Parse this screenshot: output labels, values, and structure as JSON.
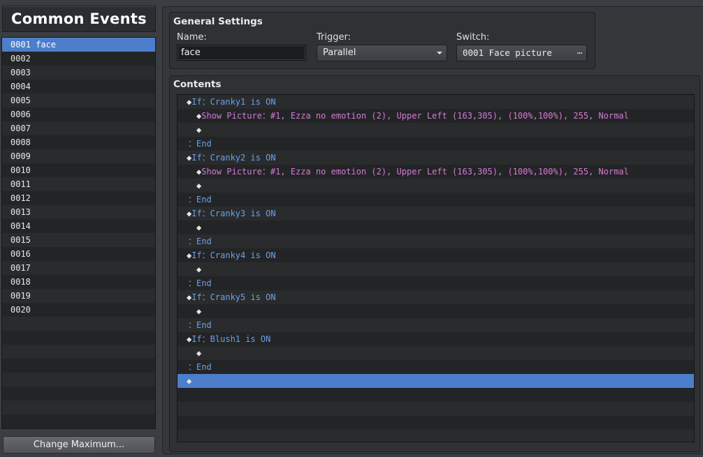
{
  "panel": {
    "title": "Common Events"
  },
  "events": [
    {
      "id": "0001",
      "name": "face",
      "selected": true
    },
    {
      "id": "0002",
      "name": ""
    },
    {
      "id": "0003",
      "name": ""
    },
    {
      "id": "0004",
      "name": ""
    },
    {
      "id": "0005",
      "name": ""
    },
    {
      "id": "0006",
      "name": ""
    },
    {
      "id": "0007",
      "name": ""
    },
    {
      "id": "0008",
      "name": ""
    },
    {
      "id": "0009",
      "name": ""
    },
    {
      "id": "0010",
      "name": ""
    },
    {
      "id": "0011",
      "name": ""
    },
    {
      "id": "0012",
      "name": ""
    },
    {
      "id": "0013",
      "name": ""
    },
    {
      "id": "0014",
      "name": ""
    },
    {
      "id": "0015",
      "name": ""
    },
    {
      "id": "0016",
      "name": ""
    },
    {
      "id": "0017",
      "name": ""
    },
    {
      "id": "0018",
      "name": ""
    },
    {
      "id": "0019",
      "name": ""
    },
    {
      "id": "0020",
      "name": ""
    }
  ],
  "change_max_label": "Change Maximum...",
  "general": {
    "title": "General Settings",
    "name_label": "Name:",
    "name_value": "face",
    "trigger_label": "Trigger:",
    "trigger_value": "Parallel",
    "switch_label": "Switch:",
    "switch_value": "0001 Face picture",
    "switch_button": "⋯"
  },
  "contents": {
    "title": "Contents",
    "commands": [
      {
        "indent": 1,
        "diamond": true,
        "text": "If：Cranky1 is ON",
        "color": "blue"
      },
      {
        "indent": 2,
        "diamond": true,
        "text": "Show Picture：#1, Ezza no emotion (2), Upper Left (163,305), (100%,100%), 255, Normal",
        "color": "pink"
      },
      {
        "indent": 2,
        "diamond": true,
        "text": "",
        "color": "blue"
      },
      {
        "indent": 1,
        "diamond": false,
        "text": "：End",
        "color": "blue"
      },
      {
        "indent": 1,
        "diamond": true,
        "text": "If：Cranky2 is ON",
        "color": "blue"
      },
      {
        "indent": 2,
        "diamond": true,
        "text": "Show Picture：#1, Ezza no emotion (2), Upper Left (163,305), (100%,100%), 255, Normal",
        "color": "pink"
      },
      {
        "indent": 2,
        "diamond": true,
        "text": "",
        "color": "blue"
      },
      {
        "indent": 1,
        "diamond": false,
        "text": "：End",
        "color": "blue"
      },
      {
        "indent": 1,
        "diamond": true,
        "text": "If：Cranky3 is ON",
        "color": "blue"
      },
      {
        "indent": 2,
        "diamond": true,
        "text": "",
        "color": "blue"
      },
      {
        "indent": 1,
        "diamond": false,
        "text": "：End",
        "color": "blue"
      },
      {
        "indent": 1,
        "diamond": true,
        "text": "If：Cranky4 is ON",
        "color": "blue"
      },
      {
        "indent": 2,
        "diamond": true,
        "text": "",
        "color": "blue"
      },
      {
        "indent": 1,
        "diamond": false,
        "text": "：End",
        "color": "blue"
      },
      {
        "indent": 1,
        "diamond": true,
        "text": "If：Cranky5 is ON",
        "color": "blue"
      },
      {
        "indent": 2,
        "diamond": true,
        "text": "",
        "color": "blue"
      },
      {
        "indent": 1,
        "diamond": false,
        "text": "：End",
        "color": "blue"
      },
      {
        "indent": 1,
        "diamond": true,
        "text": "If：Blush1 is ON",
        "color": "blue"
      },
      {
        "indent": 2,
        "diamond": true,
        "text": "",
        "color": "blue"
      },
      {
        "indent": 1,
        "diamond": false,
        "text": "：End",
        "color": "blue"
      },
      {
        "indent": 1,
        "diamond": true,
        "text": "",
        "color": "blue",
        "selected": true
      }
    ]
  },
  "colors": {
    "selection": "#4c7ecc",
    "command_blue": "#6aa2e8",
    "command_pink": "#d67ad6"
  }
}
